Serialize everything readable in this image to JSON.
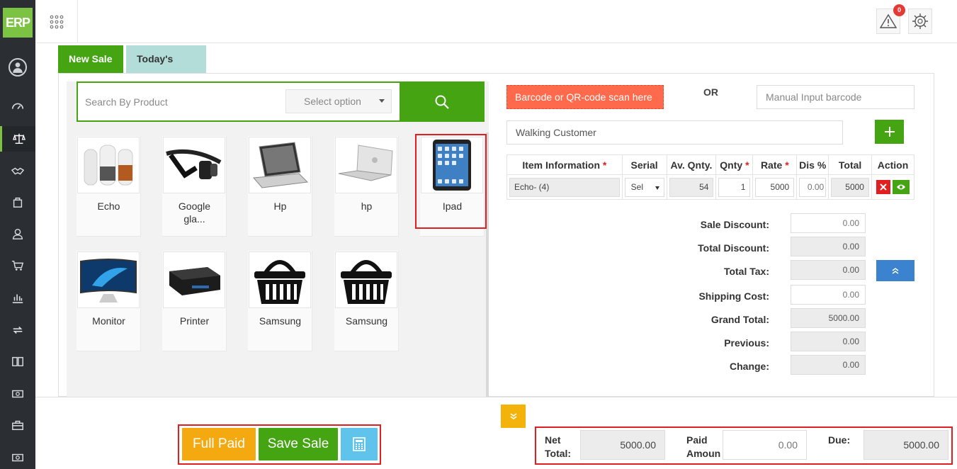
{
  "app": {
    "logo_text": "ERP",
    "notification_count": "0"
  },
  "tabs": {
    "new_sale": "New Sale",
    "todays_sale": "Today's Sale"
  },
  "search": {
    "placeholder": "Search By Product",
    "select_placeholder": "Select option"
  },
  "products": [
    {
      "name": "Echo",
      "icon": "smart-speaker-image"
    },
    {
      "name": "Google gla...",
      "icon": "smart-glasses-image"
    },
    {
      "name": "Hp",
      "icon": "laptop-image"
    },
    {
      "name": "hp",
      "icon": "laptop-image"
    },
    {
      "name": "Ipad",
      "icon": "tablet-image"
    },
    {
      "name": "Monitor",
      "icon": "monitor-image"
    },
    {
      "name": "Printer",
      "icon": "printer-image"
    },
    {
      "name": "Samsung",
      "icon": "basket-image"
    },
    {
      "name": "Samsung",
      "icon": "basket-image"
    }
  ],
  "scan": {
    "barcode_label": "Barcode or QR-code scan here",
    "or_text": "OR",
    "manual_placeholder": "Manual Input barcode"
  },
  "customer": {
    "value": "Walking Customer"
  },
  "table": {
    "headers": {
      "item": "Item Information",
      "serial": "Serial",
      "av_qnty": "Av. Qnty.",
      "qnty": "Qnty",
      "rate": "Rate",
      "dis": "Dis %",
      "total": "Total",
      "action": "Action"
    },
    "required_mark": "*",
    "row": {
      "item": "Echo- (4)",
      "serial": "Sel",
      "av_qnty": "54",
      "qnty": "1",
      "rate": "5000",
      "dis_placeholder": "0.00",
      "total": "5000"
    }
  },
  "summary": {
    "sale_discount_label": "Sale Discount:",
    "sale_discount": "0.00",
    "total_discount_label": "Total Discount:",
    "total_discount": "0.00",
    "total_tax_label": "Total Tax:",
    "total_tax": "0.00",
    "shipping_cost_label": "Shipping Cost:",
    "shipping_cost": "0.00",
    "grand_total_label": "Grand Total:",
    "grand_total": "5000.00",
    "previous_label": "Previous:",
    "previous": "0.00",
    "change_label": "Change:",
    "change": "0.00"
  },
  "footer": {
    "full_paid": "Full Paid",
    "save_sale": "Save Sale",
    "net_total_label_1": "Net",
    "net_total_label_2": "Total:",
    "net_total": "5000.00",
    "paid_label_1": "Paid",
    "paid_label_2": "Amoun",
    "paid_placeholder": "0.00",
    "due_label": "Due:",
    "due": "5000.00"
  },
  "colors": {
    "brand_green": "#44a412",
    "logo_green": "#7cc243",
    "sidebar": "#2b2f33",
    "scan_orange": "#ff6a4d",
    "warn_yellow": "#f4a910",
    "calc_blue": "#5fc3eb",
    "highlight_red": "#e02020"
  }
}
